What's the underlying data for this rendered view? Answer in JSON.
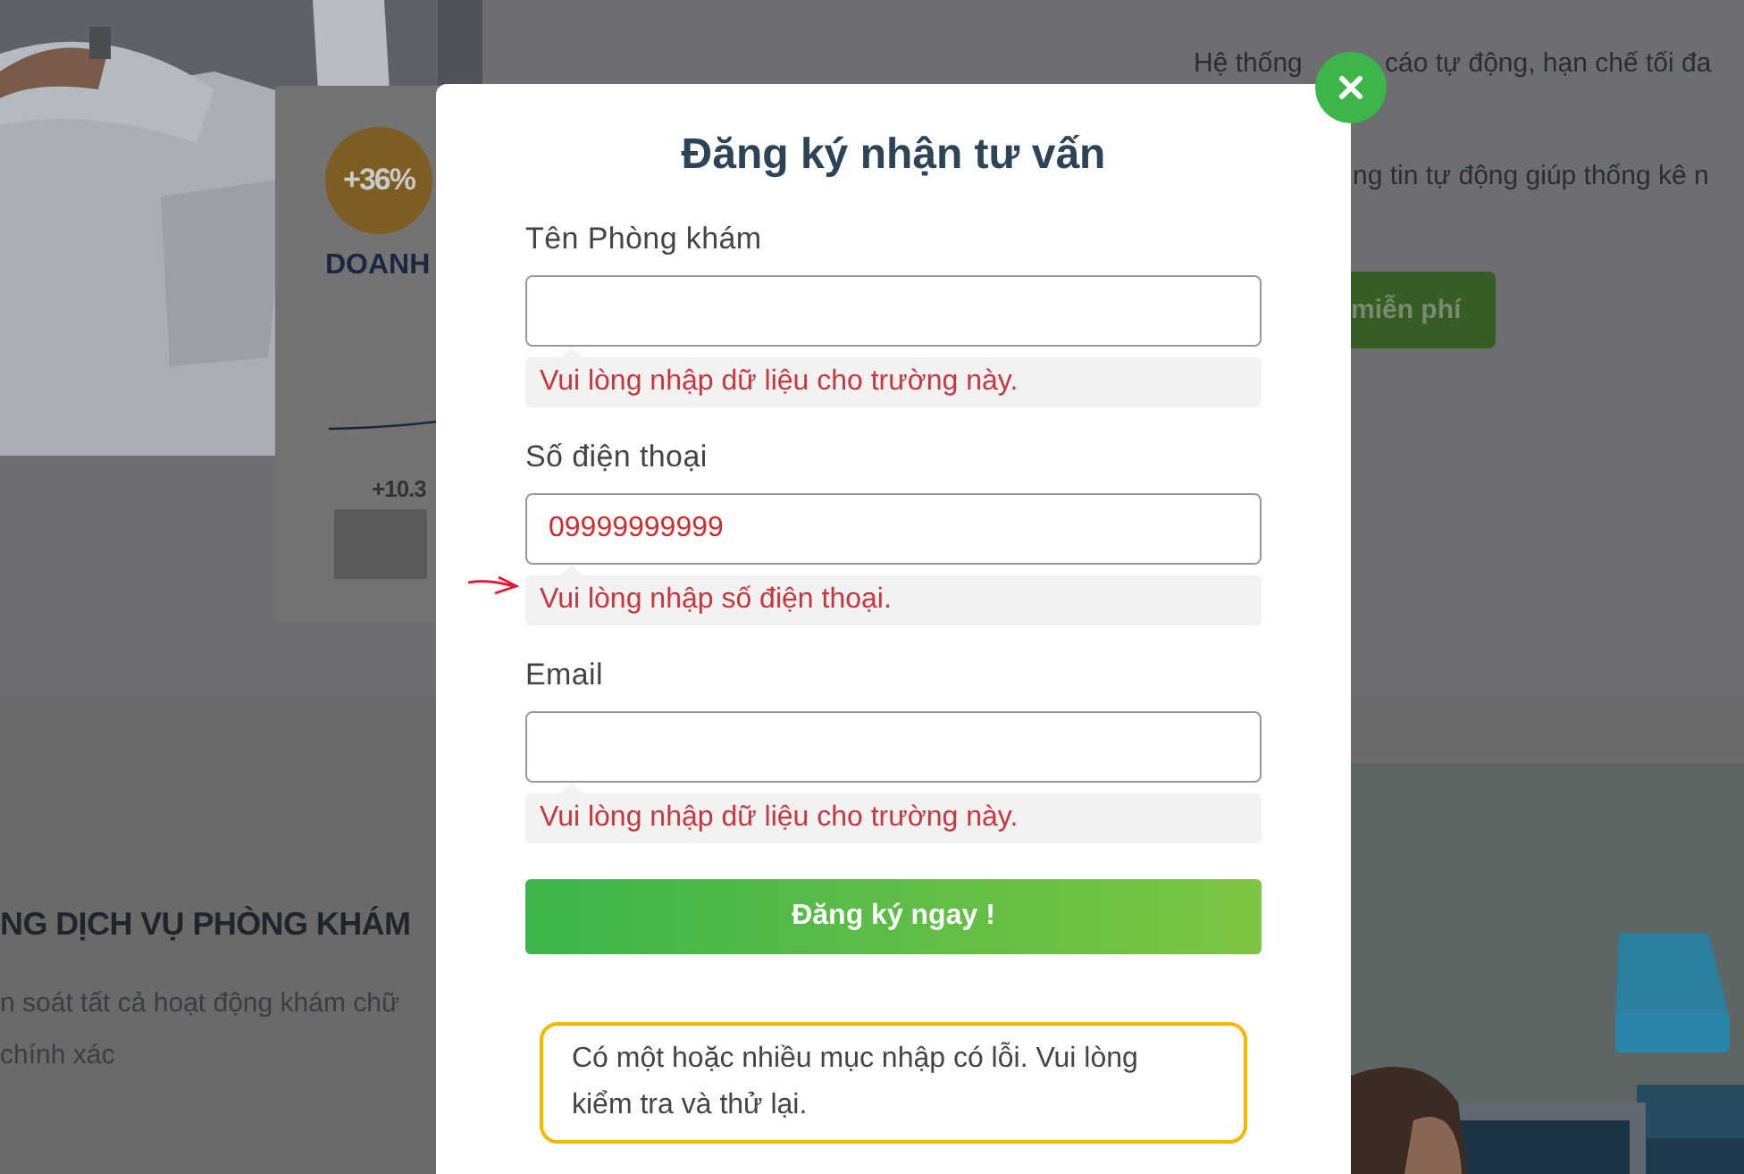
{
  "background": {
    "stats_card": {
      "badge": "+36%",
      "title": "DOANH",
      "bar_label": "+10.3"
    },
    "right_texts": [
      "Hệ thống",
      "cáo tự động, hạn chế tối đa",
      "ng tin tự động giúp thống kê n"
    ],
    "cta_button": "miễn phí",
    "section_title": "NG DỊCH VỤ PHÒNG KHÁM",
    "section_lines": [
      "n soát tất cả hoạt động khám chữ",
      "chính xác"
    ]
  },
  "modal": {
    "title": "Đăng ký nhận tư vấn",
    "fields": [
      {
        "label": "Tên Phòng khám",
        "error": "Vui lòng nhập dữ liệu cho trường này."
      },
      {
        "label": "Số điện thoại",
        "value": "09999999999",
        "error": "Vui lòng nhập số điện thoại."
      },
      {
        "label": "Email",
        "error": "Vui lòng nhập dữ liệu cho trường này."
      }
    ],
    "submit": "Đăng ký ngay !",
    "alert": "Có một hoặc nhiều mục nhập có lỗi. Vui lòng kiểm tra và thử lại."
  }
}
